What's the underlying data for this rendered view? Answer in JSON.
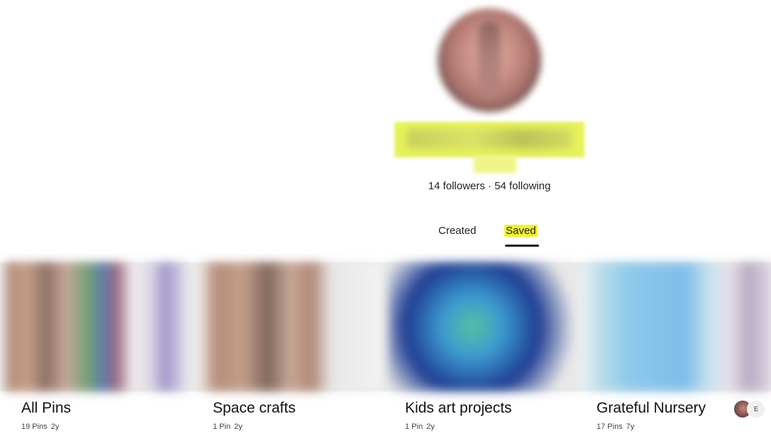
{
  "profile": {
    "followers_text": "14 followers · 54 following"
  },
  "tabs": {
    "created_label": "Created",
    "saved_label": "Saved",
    "active": "Saved"
  },
  "boards": [
    {
      "title": "All Pins",
      "pins": "19 Pins",
      "age": "2y"
    },
    {
      "title": "Space crafts",
      "pins": "1 Pin",
      "age": "2y"
    },
    {
      "title": "Kids art projects",
      "pins": "1 Pin",
      "age": "2y"
    },
    {
      "title": "Grateful Nursery",
      "pins": "17 Pins",
      "age": "7y",
      "collaborator_initial": "E"
    }
  ],
  "colors": {
    "highlight": "#eef22e",
    "tab_underline": "#111111"
  }
}
